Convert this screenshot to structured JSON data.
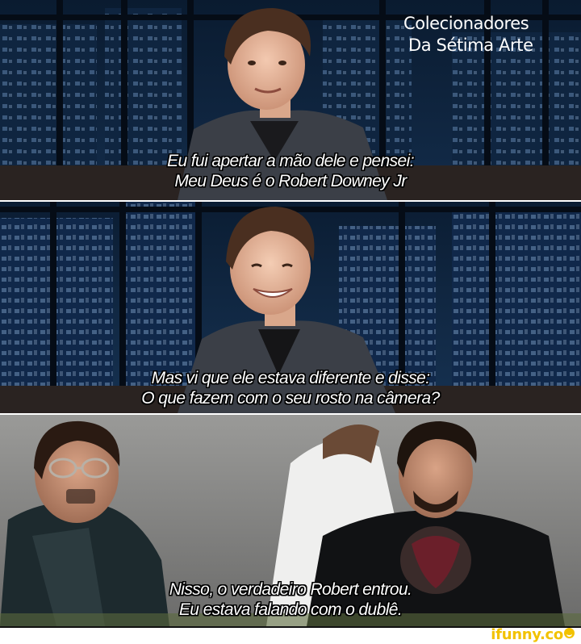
{
  "watermark": {
    "line1": "Colecionadores",
    "line2": "Da Sétima Arte"
  },
  "panels": [
    {
      "caption_line1": "Eu fui apertar a mão dele e pensei:",
      "caption_line2": "Meu Deus é o Robert Downey Jr"
    },
    {
      "caption_line1": "Mas vi que ele estava diferente e disse:",
      "caption_line2": "O que fazem com o seu rosto na câmera?"
    },
    {
      "caption_line1": "Nisso, o verdadeiro Robert entrou.",
      "caption_line2": "Eu estava falando com o dublê."
    }
  ],
  "footer": {
    "logo_text": "ifunny.co"
  },
  "colors": {
    "caption_text": "#ffffff",
    "caption_outline": "#000000",
    "logo": "#f2c200",
    "night_sky": "#0b1d33",
    "window_light": "#6f8fb5"
  }
}
